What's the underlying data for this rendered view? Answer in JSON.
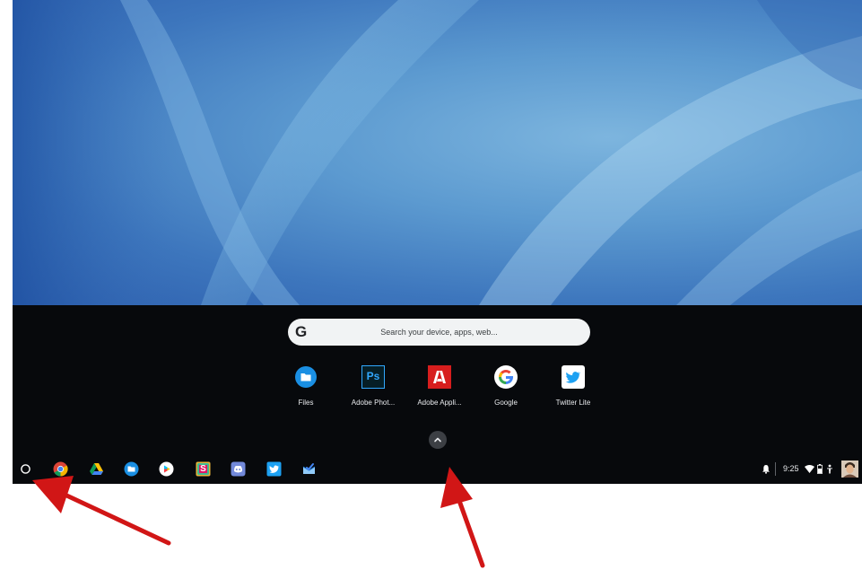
{
  "search": {
    "logo": "G",
    "placeholder": "Search your device, apps, web..."
  },
  "suggested_apps": [
    {
      "label": "Files",
      "icon": "files-icon"
    },
    {
      "label": "Adobe Phot...",
      "icon": "photoshop-icon",
      "glyph": "Ps"
    },
    {
      "label": "Adobe Appli...",
      "icon": "adobe-icon"
    },
    {
      "label": "Google",
      "icon": "google-icon",
      "glyph": "G"
    },
    {
      "label": "Twitter Lite",
      "icon": "twitter-icon"
    }
  ],
  "shelf": {
    "apps": [
      "launcher-icon",
      "chrome-icon",
      "drive-icon",
      "files-icon",
      "play-store-icon",
      "slack-icon",
      "discord-icon",
      "twitter-icon",
      "inbox-icon"
    ],
    "slack_glyph": "S"
  },
  "status": {
    "time": "9:25",
    "icons": [
      "notification-bell-icon",
      "wifi-icon",
      "battery-icon",
      "person-icon",
      "avatar"
    ]
  },
  "colors": {
    "wallpaper": "#4a86c6",
    "launcher_bg": "#07090c",
    "annotation_arrow": "#d11616"
  }
}
